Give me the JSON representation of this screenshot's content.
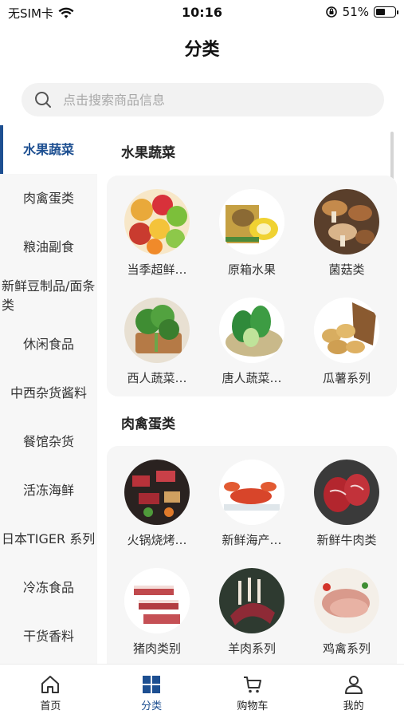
{
  "status_bar": {
    "carrier": "无SIM卡",
    "time": "10:16",
    "battery": "51%",
    "battery_level": 0.51
  },
  "header": {
    "title": "分类"
  },
  "search": {
    "placeholder": "点击搜索商品信息"
  },
  "sidebar": {
    "items": [
      {
        "label": "水果蔬菜",
        "active": true
      },
      {
        "label": "肉禽蛋类"
      },
      {
        "label": "粮油副食"
      },
      {
        "label": "新鲜豆制品/面条类"
      },
      {
        "label": "休闲食品"
      },
      {
        "label": "中西杂货酱料"
      },
      {
        "label": "餐馆杂货"
      },
      {
        "label": "活冻海鲜"
      },
      {
        "label": "日本TIGER 系列"
      },
      {
        "label": "冷冻食品"
      },
      {
        "label": "干货香料"
      }
    ]
  },
  "sections": [
    {
      "title": "水果蔬菜",
      "items": [
        {
          "label": "当季超鲜…",
          "icon": "mixed-fruit"
        },
        {
          "label": "原箱水果",
          "icon": "kiwi-box"
        },
        {
          "label": "菌菇类",
          "icon": "mushrooms"
        },
        {
          "label": "西人蔬菜…",
          "icon": "herbs"
        },
        {
          "label": "唐人蔬菜…",
          "icon": "bok-choy"
        },
        {
          "label": "瓜薯系列",
          "icon": "potatoes"
        }
      ]
    },
    {
      "title": "肉禽蛋类",
      "items": [
        {
          "label": "火锅烧烤…",
          "icon": "bbq-grill"
        },
        {
          "label": "新鲜海产…",
          "icon": "lobster"
        },
        {
          "label": "新鲜牛肉类",
          "icon": "beef-steak"
        },
        {
          "label": "猪肉类别",
          "icon": "pork-belly"
        },
        {
          "label": "羊肉系列",
          "icon": "lamb-rack"
        },
        {
          "label": "鸡禽系列",
          "icon": "chicken-breast"
        }
      ]
    }
  ],
  "tab_bar": {
    "tabs": [
      {
        "label": "首页"
      },
      {
        "label": "分类",
        "active": true
      },
      {
        "label": "购物车"
      },
      {
        "label": "我的"
      }
    ]
  },
  "colors": {
    "accent": "#1d4f91",
    "sidebar_bg": "#f7f7f7",
    "card_bg": "#f6f6f6"
  }
}
